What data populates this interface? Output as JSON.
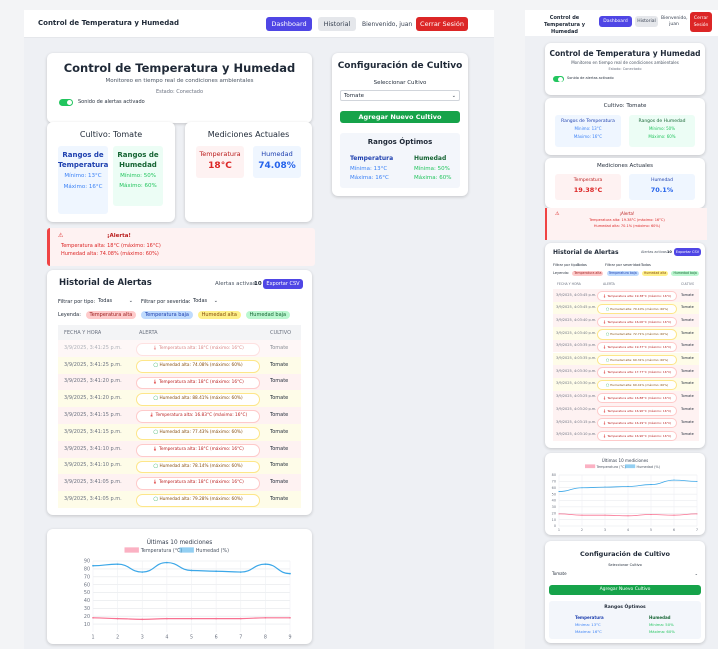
{
  "left": {
    "nav": {
      "title": "Control de Temperatura y Humedad",
      "dashboard": "Dashboard",
      "historial": "Historial",
      "welcome": "Bienvenido, juan",
      "logout": "Cerrar Sesión"
    },
    "header": {
      "title": "Control de Temperatura y Humedad",
      "subtitle": "Monitoreo en tiempo real de condiciones ambientales",
      "status": "Estado: Conectado",
      "sound": "Sonido de alertas activado"
    },
    "crop": {
      "title": "Cultivo: Tomate",
      "temp_title": "Rangos de Temperatura",
      "temp_min": "Mínimo: 13°C",
      "temp_max": "Máximo: 16°C",
      "hum_title": "Rangos de Humedad",
      "hum_min": "Mínimo: 50%",
      "hum_max": "Máximo: 60%"
    },
    "measure": {
      "title": "Mediciones Actuales",
      "temp_label": "Temperatura",
      "temp_value": "18°C",
      "hum_label": "Humedad",
      "hum_value": "74.08%"
    },
    "config": {
      "title": "Configuración de Cultivo",
      "select_label": "Seleccionar Cultivo",
      "select_value": "Tomate",
      "add_button": "Agregar Nuevo Cultivo",
      "optimal_title": "Rangos Óptimos",
      "temp_head": "Temperatura",
      "hum_head": "Humedad",
      "temp_min": "Mínima: 13°C",
      "temp_max": "Máxima: 16°C",
      "hum_min": "Mínima: 50%",
      "hum_max": "Máxima: 60%"
    },
    "alert_banner": {
      "title": "¡Alerta!",
      "line1": "Temperatura alta: 18°C (máximo: 16°C)",
      "line2": "Humedad alta: 74.08% (máximo: 60%)"
    },
    "history": {
      "title": "Historial de Alertas",
      "active_label": "Alertas activas:",
      "active_count": "10",
      "export": "Exportar CSV",
      "filter_type_label": "Filtrar por tipo:",
      "filter_type_value": "Todas",
      "filter_sev_label": "Filtrar por severidad:",
      "filter_sev_value": "Todas",
      "legend_label": "Leyenda:",
      "legend": [
        "Temperatura alta",
        "Temperatura baja",
        "Humedad alta",
        "Humedad baja"
      ],
      "columns": [
        "FECHA Y HORA",
        "ALERTA",
        "CULTIVO"
      ],
      "rows": [
        {
          "date": "3/9/2025, 3:41:25 p.m.",
          "alert": "Temperatura alta: 18°C (máximo: 16°C)",
          "crop": "Tomate",
          "kind": "temp"
        },
        {
          "date": "3/9/2025, 3:41:25 p.m.",
          "alert": "Humedad alta: 74.08% (máximo: 60%)",
          "crop": "Tomate",
          "kind": "hum"
        },
        {
          "date": "3/9/2025, 3:41:20 p.m.",
          "alert": "Temperatura alta: 18°C (máximo: 16°C)",
          "crop": "Tomate",
          "kind": "temp"
        },
        {
          "date": "3/9/2025, 3:41:20 p.m.",
          "alert": "Humedad alta: 88.41% (máximo: 60%)",
          "crop": "Tomate",
          "kind": "hum"
        },
        {
          "date": "3/9/2025, 3:41:15 p.m.",
          "alert": "Temperatura alta: 16.83°C (máximo: 16°C)",
          "crop": "Tomate",
          "kind": "temp"
        },
        {
          "date": "3/9/2025, 3:41:15 p.m.",
          "alert": "Humedad alta: 77.43% (máximo: 60%)",
          "crop": "Tomate",
          "kind": "hum"
        },
        {
          "date": "3/9/2025, 3:41:10 p.m.",
          "alert": "Temperatura alta: 18°C (máximo: 16°C)",
          "crop": "Tomate",
          "kind": "temp"
        },
        {
          "date": "3/9/2025, 3:41:10 p.m.",
          "alert": "Humedad alta: 78.14% (máximo: 60%)",
          "crop": "Tomate",
          "kind": "hum"
        },
        {
          "date": "3/9/2025, 3:41:05 p.m.",
          "alert": "Temperatura alta: 18°C (máximo: 16°C)",
          "crop": "Tomate",
          "kind": "temp"
        },
        {
          "date": "3/9/2025, 3:41:05 p.m.",
          "alert": "Humedad alta: 79.28% (máximo: 60%)",
          "crop": "Tomate",
          "kind": "hum"
        }
      ]
    }
  },
  "right": {
    "nav": {
      "title": "Control de Temperatura y Humedad",
      "dashboard": "Dashboard",
      "historial": "Historial",
      "welcome": "Bienvenido, juan",
      "logout": "Cerrar Sesión"
    },
    "header": {
      "title": "Control de Temperatura y Humedad",
      "subtitle": "Monitoreo en tiempo real de condiciones ambientales",
      "status": "Estado: Conectado",
      "sound": "Sonido de alertas activado"
    },
    "crop": {
      "title": "Cultivo: Tomate",
      "temp_title": "Rangos de Temperatura",
      "temp_min": "Mínimo: 13°C",
      "temp_max": "Máximo: 16°C",
      "hum_title": "Rangos de Humedad",
      "hum_min": "Mínimo: 50%",
      "hum_max": "Máximo: 60%"
    },
    "measure": {
      "title": "Mediciones Actuales",
      "temp_label": "Temperatura",
      "temp_value": "19.38°C",
      "hum_label": "Humedad",
      "hum_value": "70.1%"
    },
    "alert_banner": {
      "title": "¡Alerta!",
      "line1": "Temperatura alta: 19.38°C (máximo: 16°C)",
      "line2": "Humedad alta: 70.1% (máximo: 60%)"
    },
    "history": {
      "title": "Historial de Alertas",
      "active_label": "Alertas activas:",
      "active_count": "10",
      "export": "Exportar CSV",
      "filter_type_label": "Filtrar por tipo:",
      "filter_type_value": "Todas",
      "filter_sev_label": "Filtrar por severidad:",
      "filter_sev_value": "Todas",
      "legend_label": "Leyenda:",
      "legend": [
        "Temperatura alta",
        "Temperatura baja",
        "Humedad alta",
        "Humedad baja"
      ],
      "columns": [
        "FECHA Y HORA",
        "ALERTA",
        "CULTIVO"
      ],
      "rows": [
        {
          "date": "3/9/2025, 4:03:45 p.m.",
          "alert": "Temperatura alta: 19.38°C (máximo: 16°C)",
          "crop": "Tomate",
          "kind": "temp"
        },
        {
          "date": "3/9/2025, 4:03:45 p.m.",
          "alert": "Humedad alta: 70.10% (máximo: 60%)",
          "crop": "Tomate",
          "kind": "hum"
        },
        {
          "date": "3/9/2025, 4:03:40 p.m.",
          "alert": "Temperatura alta: 16.00°C (máximo: 16°C)",
          "crop": "Tomate",
          "kind": "temp"
        },
        {
          "date": "3/9/2025, 4:03:40 p.m.",
          "alert": "Humedad alta: 72.71% (máximo: 60%)",
          "crop": "Tomate",
          "kind": "hum"
        },
        {
          "date": "3/9/2025, 4:03:35 p.m.",
          "alert": "Temperatura alta: 19.37°C (máximo: 16°C)",
          "crop": "Tomate",
          "kind": "temp"
        },
        {
          "date": "3/9/2025, 4:03:35 p.m.",
          "alert": "Humedad alta: 60.31% (máximo: 60%)",
          "crop": "Tomate",
          "kind": "hum"
        },
        {
          "date": "3/9/2025, 4:03:30 p.m.",
          "alert": "Temperatura alta: 17.77°C (máximo: 16°C)",
          "crop": "Tomate",
          "kind": "temp"
        },
        {
          "date": "3/9/2025, 4:03:30 p.m.",
          "alert": "Humedad alta: 60.41% (máximo: 60%)",
          "crop": "Tomate",
          "kind": "hum"
        },
        {
          "date": "3/9/2025, 4:03:25 p.m.",
          "alert": "Temperatura alta: 16.88°C (máximo: 16°C)",
          "crop": "Tomate",
          "kind": "temp"
        },
        {
          "date": "3/9/2025, 4:03:20 p.m.",
          "alert": "Temperatura alta: 16.90°C (máximo: 16°C)",
          "crop": "Tomate",
          "kind": "temp"
        },
        {
          "date": "3/9/2025, 4:03:15 p.m.",
          "alert": "Temperatura alta: 16.29°C (máximo: 16°C)",
          "crop": "Tomate",
          "kind": "temp"
        },
        {
          "date": "3/9/2025, 4:03:10 p.m.",
          "alert": "Temperatura alta: 16.90°C (máximo: 16°C)",
          "crop": "Tomate",
          "kind": "temp"
        }
      ]
    },
    "config": {
      "title": "Configuración de Cultivo",
      "select_label": "Seleccionar Cultivo",
      "select_value": "Tomate",
      "add_button": "Agregar Nuevo Cultivo",
      "optimal_title": "Rangos Óptimos",
      "temp_head": "Temperatura",
      "hum_head": "Humedad",
      "temp_min": "Mínima: 13°C",
      "temp_max": "Máxima: 16°C",
      "hum_min": "Mínima: 50%",
      "hum_max": "Máxima: 60%"
    }
  },
  "colors": {
    "primary": "#4f46e5",
    "danger": "#dc2626",
    "success": "#16a34a",
    "temp_line": "#f87191",
    "hum_line": "#3ba7e8"
  },
  "chart_data": [
    {
      "type": "line",
      "title": "Últimas 10 mediciones",
      "x": [
        1,
        2,
        3,
        4,
        5,
        6,
        7,
        8,
        9
      ],
      "series": [
        {
          "name": "Temperatura (°C)",
          "values": [
            18,
            17,
            16,
            17,
            17,
            17,
            17,
            18,
            18
          ]
        },
        {
          "name": "Humedad (%)",
          "values": [
            84,
            86,
            76,
            88,
            78,
            77,
            76,
            86,
            74
          ]
        }
      ],
      "ylim": [
        0,
        90
      ],
      "yticks": [
        10,
        20,
        30,
        40,
        50,
        60,
        70,
        80,
        90
      ],
      "grid": true,
      "legend": "top"
    },
    {
      "type": "line",
      "title": "Últimas 10 mediciones",
      "x": [
        1,
        2,
        3,
        4,
        5,
        6,
        7
      ],
      "series": [
        {
          "name": "Temperatura (°C)",
          "values": [
            19,
            17,
            17,
            16,
            18,
            17,
            19
          ]
        },
        {
          "name": "Humedad (%)",
          "values": [
            54,
            60,
            61,
            62,
            65,
            72,
            70
          ]
        }
      ],
      "ylim": [
        0,
        80
      ],
      "yticks": [
        0,
        10,
        20,
        30,
        40,
        50,
        60,
        70,
        80
      ],
      "grid": true,
      "legend": "top"
    }
  ]
}
